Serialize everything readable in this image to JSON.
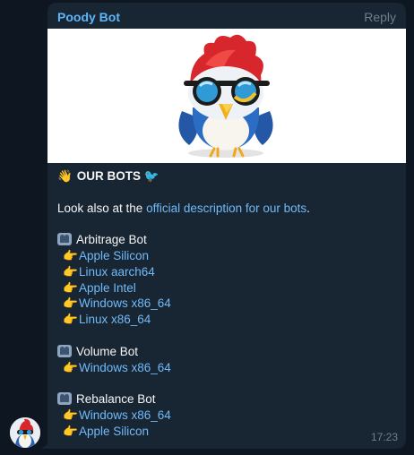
{
  "message": {
    "sender": "Poody Bot",
    "reply_label": "Reply",
    "time": "17:23",
    "heading_emoji": "👋",
    "heading": "OUR BOTS",
    "heading_trailing_emoji": "🐦",
    "intro_text": "Look also at the ",
    "intro_link": "official description for our bots",
    "intro_end": ".",
    "pointer_emoji": "👉",
    "sections": [
      {
        "title": "Arbitrage Bot",
        "links": [
          "Apple Silicon",
          "Linux aarch64",
          "Apple Intel",
          "Windows x86_64",
          "Linux x86_64"
        ]
      },
      {
        "title": "Volume Bot",
        "links": [
          "Windows x86_64"
        ]
      },
      {
        "title": "Rebalance Bot",
        "links": [
          "Windows x86_64",
          "Apple Silicon"
        ]
      }
    ]
  },
  "media": {
    "image": "woodpecker-mascot-with-sunglasses"
  },
  "colors": {
    "chat_background": "#0e1621",
    "bubble": "#182533",
    "sender_name": "#5eb5f7",
    "link": "#71baf8",
    "muted": "#6d7f8f",
    "text": "#f5f5f5"
  }
}
